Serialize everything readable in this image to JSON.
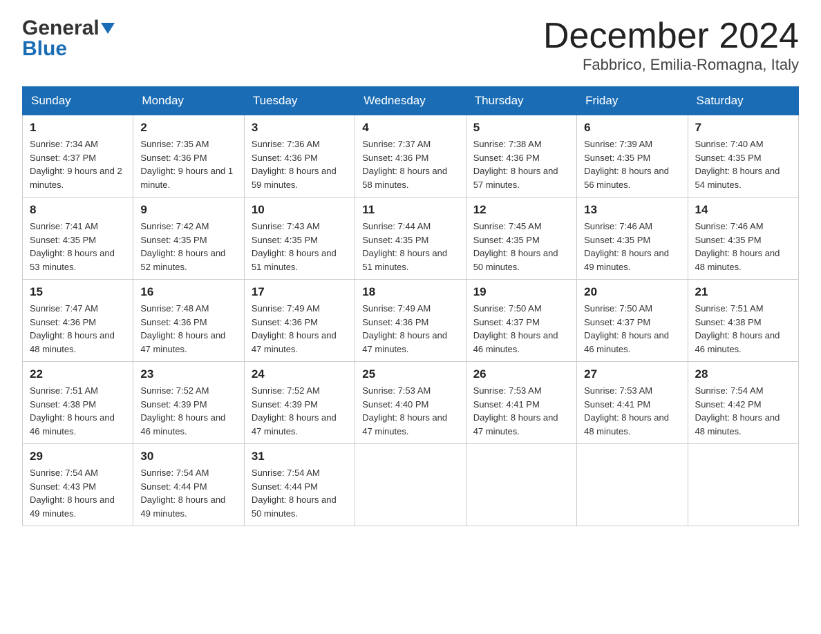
{
  "header": {
    "logo_general": "General",
    "logo_blue": "Blue",
    "month_title": "December 2024",
    "location": "Fabbrico, Emilia-Romagna, Italy"
  },
  "days_of_week": [
    "Sunday",
    "Monday",
    "Tuesday",
    "Wednesday",
    "Thursday",
    "Friday",
    "Saturday"
  ],
  "weeks": [
    [
      {
        "day": "1",
        "sunrise": "7:34 AM",
        "sunset": "4:37 PM",
        "daylight": "9 hours and 2 minutes."
      },
      {
        "day": "2",
        "sunrise": "7:35 AM",
        "sunset": "4:36 PM",
        "daylight": "9 hours and 1 minute."
      },
      {
        "day": "3",
        "sunrise": "7:36 AM",
        "sunset": "4:36 PM",
        "daylight": "8 hours and 59 minutes."
      },
      {
        "day": "4",
        "sunrise": "7:37 AM",
        "sunset": "4:36 PM",
        "daylight": "8 hours and 58 minutes."
      },
      {
        "day": "5",
        "sunrise": "7:38 AM",
        "sunset": "4:36 PM",
        "daylight": "8 hours and 57 minutes."
      },
      {
        "day": "6",
        "sunrise": "7:39 AM",
        "sunset": "4:35 PM",
        "daylight": "8 hours and 56 minutes."
      },
      {
        "day": "7",
        "sunrise": "7:40 AM",
        "sunset": "4:35 PM",
        "daylight": "8 hours and 54 minutes."
      }
    ],
    [
      {
        "day": "8",
        "sunrise": "7:41 AM",
        "sunset": "4:35 PM",
        "daylight": "8 hours and 53 minutes."
      },
      {
        "day": "9",
        "sunrise": "7:42 AM",
        "sunset": "4:35 PM",
        "daylight": "8 hours and 52 minutes."
      },
      {
        "day": "10",
        "sunrise": "7:43 AM",
        "sunset": "4:35 PM",
        "daylight": "8 hours and 51 minutes."
      },
      {
        "day": "11",
        "sunrise": "7:44 AM",
        "sunset": "4:35 PM",
        "daylight": "8 hours and 51 minutes."
      },
      {
        "day": "12",
        "sunrise": "7:45 AM",
        "sunset": "4:35 PM",
        "daylight": "8 hours and 50 minutes."
      },
      {
        "day": "13",
        "sunrise": "7:46 AM",
        "sunset": "4:35 PM",
        "daylight": "8 hours and 49 minutes."
      },
      {
        "day": "14",
        "sunrise": "7:46 AM",
        "sunset": "4:35 PM",
        "daylight": "8 hours and 48 minutes."
      }
    ],
    [
      {
        "day": "15",
        "sunrise": "7:47 AM",
        "sunset": "4:36 PM",
        "daylight": "8 hours and 48 minutes."
      },
      {
        "day": "16",
        "sunrise": "7:48 AM",
        "sunset": "4:36 PM",
        "daylight": "8 hours and 47 minutes."
      },
      {
        "day": "17",
        "sunrise": "7:49 AM",
        "sunset": "4:36 PM",
        "daylight": "8 hours and 47 minutes."
      },
      {
        "day": "18",
        "sunrise": "7:49 AM",
        "sunset": "4:36 PM",
        "daylight": "8 hours and 47 minutes."
      },
      {
        "day": "19",
        "sunrise": "7:50 AM",
        "sunset": "4:37 PM",
        "daylight": "8 hours and 46 minutes."
      },
      {
        "day": "20",
        "sunrise": "7:50 AM",
        "sunset": "4:37 PM",
        "daylight": "8 hours and 46 minutes."
      },
      {
        "day": "21",
        "sunrise": "7:51 AM",
        "sunset": "4:38 PM",
        "daylight": "8 hours and 46 minutes."
      }
    ],
    [
      {
        "day": "22",
        "sunrise": "7:51 AM",
        "sunset": "4:38 PM",
        "daylight": "8 hours and 46 minutes."
      },
      {
        "day": "23",
        "sunrise": "7:52 AM",
        "sunset": "4:39 PM",
        "daylight": "8 hours and 46 minutes."
      },
      {
        "day": "24",
        "sunrise": "7:52 AM",
        "sunset": "4:39 PM",
        "daylight": "8 hours and 47 minutes."
      },
      {
        "day": "25",
        "sunrise": "7:53 AM",
        "sunset": "4:40 PM",
        "daylight": "8 hours and 47 minutes."
      },
      {
        "day": "26",
        "sunrise": "7:53 AM",
        "sunset": "4:41 PM",
        "daylight": "8 hours and 47 minutes."
      },
      {
        "day": "27",
        "sunrise": "7:53 AM",
        "sunset": "4:41 PM",
        "daylight": "8 hours and 48 minutes."
      },
      {
        "day": "28",
        "sunrise": "7:54 AM",
        "sunset": "4:42 PM",
        "daylight": "8 hours and 48 minutes."
      }
    ],
    [
      {
        "day": "29",
        "sunrise": "7:54 AM",
        "sunset": "4:43 PM",
        "daylight": "8 hours and 49 minutes."
      },
      {
        "day": "30",
        "sunrise": "7:54 AM",
        "sunset": "4:44 PM",
        "daylight": "8 hours and 49 minutes."
      },
      {
        "day": "31",
        "sunrise": "7:54 AM",
        "sunset": "4:44 PM",
        "daylight": "8 hours and 50 minutes."
      },
      null,
      null,
      null,
      null
    ]
  ],
  "labels": {
    "sunrise": "Sunrise:",
    "sunset": "Sunset:",
    "daylight": "Daylight:"
  }
}
